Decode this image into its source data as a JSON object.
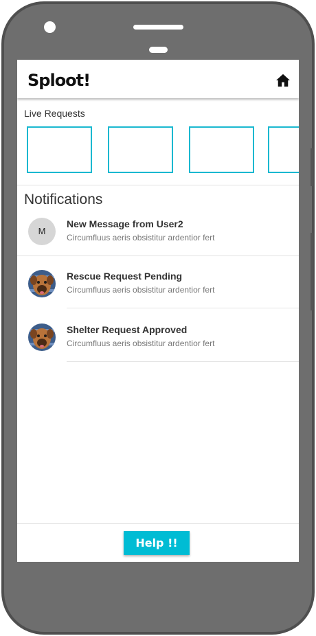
{
  "app": {
    "title": "Sploot!"
  },
  "header": {
    "home_icon": "home-icon"
  },
  "live_requests": {
    "label": "Live Requests",
    "card_count_visible": 4
  },
  "notifications": {
    "title": "Notifications",
    "items": [
      {
        "title": "New Message from User2",
        "body": "Circumfluus aeris obsistitur ardentior fert",
        "avatar_type": "letter",
        "avatar_letter": "M"
      },
      {
        "title": "Rescue Request Pending",
        "body": "Circumfluus aeris obsistitur ardentior fert",
        "avatar_type": "dog-photo"
      },
      {
        "title": "Shelter Request Approved",
        "body": "Circumfluus aeris obsistitur ardentior fert",
        "avatar_type": "dog-photo"
      }
    ]
  },
  "footer": {
    "help_label": "Help !!"
  },
  "colors": {
    "accent": "#00bcd4",
    "phone_body": "#6e6e6e",
    "card_border": "#1ab8d0"
  }
}
